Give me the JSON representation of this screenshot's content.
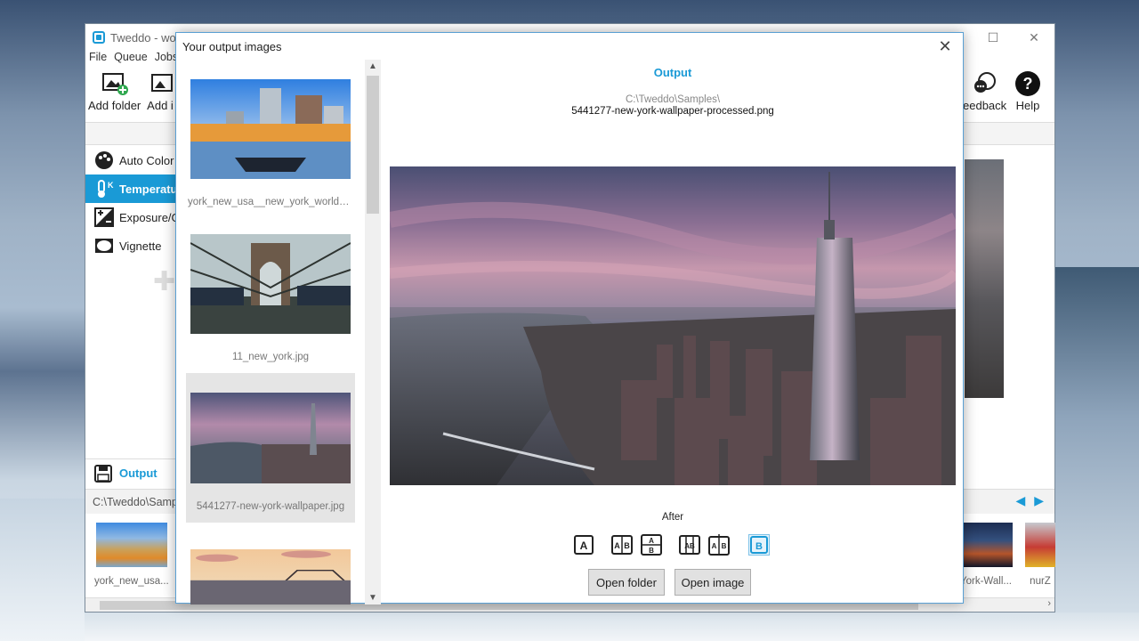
{
  "app": {
    "title": "Tweddo - worl",
    "menu": [
      "File",
      "Queue",
      "Jobs"
    ],
    "toolbar": {
      "add_folder": "Add folder",
      "add_image": "Add i",
      "feedback": "eedback",
      "help": "Help"
    },
    "effects": [
      {
        "label": "Auto Color",
        "icon": "palette-icon",
        "active": false
      },
      {
        "label": "Temperatur",
        "icon": "thermometer-icon",
        "active": true
      },
      {
        "label": "Exposure/Ga",
        "icon": "exposure-icon",
        "active": false
      },
      {
        "label": "Vignette",
        "icon": "vignette-icon",
        "active": false
      }
    ],
    "output_label": "Output",
    "output_path": "C:\\Tweddo\\Samp",
    "strip": [
      {
        "label": "york_new_usa..."
      },
      {
        "label": "York-Wall..."
      },
      {
        "label": "nurZ"
      }
    ]
  },
  "dialog": {
    "title": "Your output images",
    "list": [
      {
        "label": "york_new_usa__new_york_world_cit..."
      },
      {
        "label": "11_new_york.jpg"
      },
      {
        "label": "5441277-new-york-wallpaper.jpg",
        "selected": true
      },
      {
        "label": ""
      }
    ],
    "heading": "Output",
    "dir": "C:\\Tweddo\\Samples\\",
    "file": "5441277-new-york-wallpaper-processed.png",
    "mode_label": "After",
    "compare_modes": [
      "A",
      "A|B",
      "A/B",
      "|AB|",
      "|A B|",
      "B"
    ],
    "open_folder": "Open folder",
    "open_image": "Open image"
  },
  "colors": {
    "accent": "#1a9ad6"
  }
}
